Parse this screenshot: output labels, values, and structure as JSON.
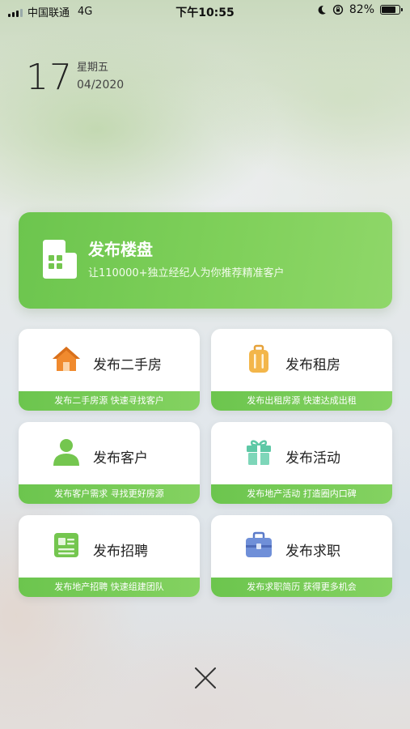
{
  "status_bar": {
    "carrier": "中国联通",
    "network": "4G",
    "time": "下午10:55",
    "battery_percent": "82%",
    "battery_level": 0.82
  },
  "date": {
    "day": "17",
    "weekday": "星期五",
    "month_year": "04/2020"
  },
  "main_card": {
    "title": "发布楼盘",
    "subtitle": "让110000+独立经纪人为你推荐精准客户",
    "icon": "building-icon"
  },
  "tiles": [
    {
      "label": "发布二手房",
      "sub": "发布二手房源 快速寻找客户",
      "icon": "house-icon"
    },
    {
      "label": "发布租房",
      "sub": "发布出租房源 快速达成出租",
      "icon": "luggage-icon"
    },
    {
      "label": "发布客户",
      "sub": "发布客户需求 寻找更好房源",
      "icon": "person-icon"
    },
    {
      "label": "发布活动",
      "sub": "发布地产活动 打造圈内口碑",
      "icon": "gift-icon"
    },
    {
      "label": "发布招聘",
      "sub": "发布地产招聘 快速组建团队",
      "icon": "document-icon"
    },
    {
      "label": "发布求职",
      "sub": "发布求职简历 获得更多机会",
      "icon": "briefcase-icon"
    }
  ],
  "colors": {
    "accent_green": "#6cc54e",
    "house_orange": "#f08a2e",
    "luggage_yellow": "#f3b64a",
    "person_green": "#74c64f",
    "gift_teal": "#5ec8a6",
    "document_green": "#74c64f",
    "briefcase_blue": "#6f8fd8"
  },
  "close_icon": "close-icon"
}
